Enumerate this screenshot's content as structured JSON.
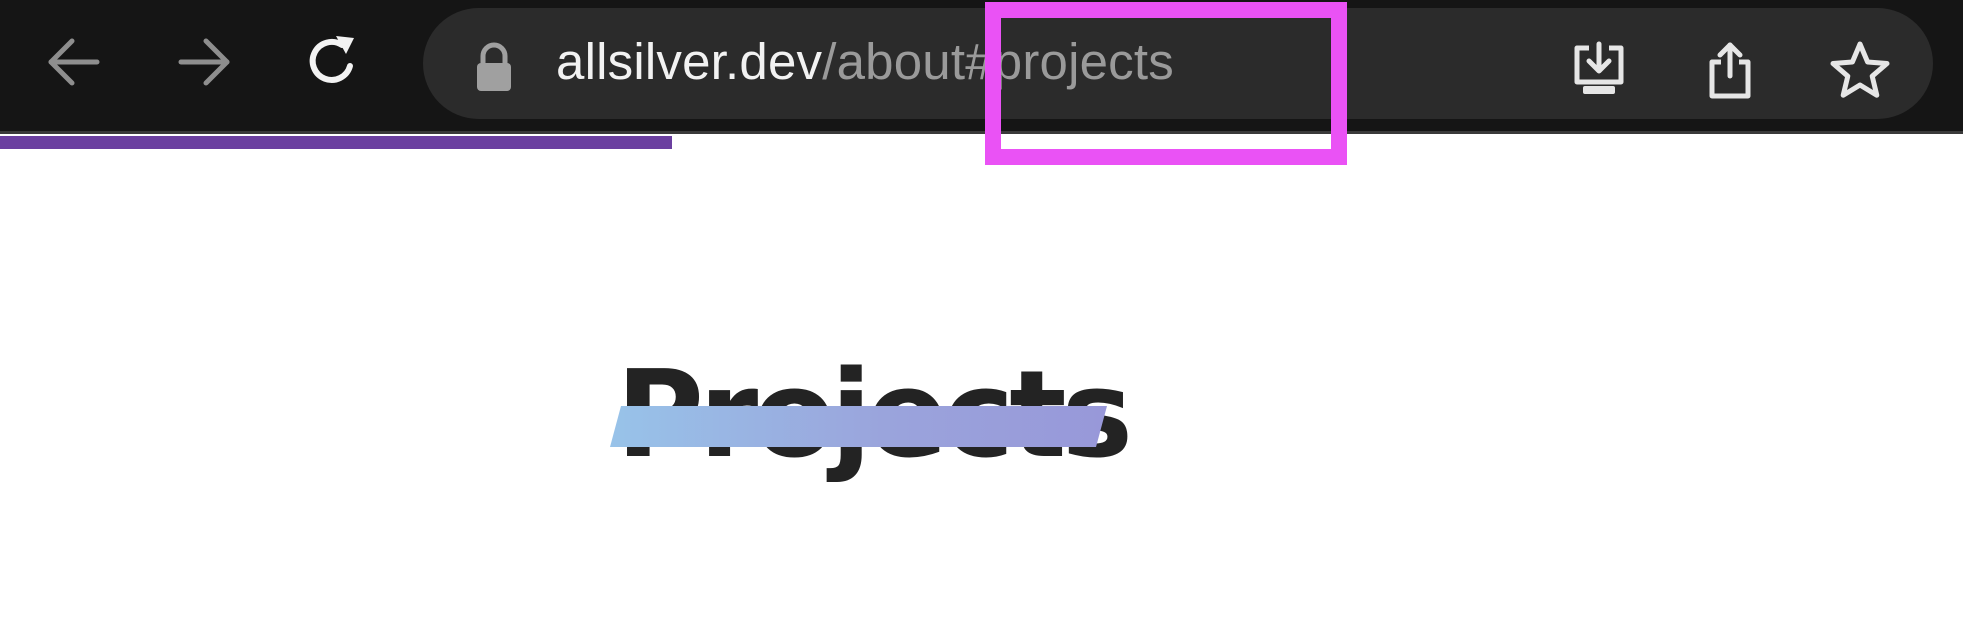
{
  "browser": {
    "nav": {
      "back_icon": "arrow-left-icon",
      "forward_icon": "arrow-right-icon",
      "reload_icon": "reload-icon"
    },
    "address_bar": {
      "lock_icon": "lock-icon",
      "url_host": "allsilver.dev",
      "url_path": "/about#projects"
    },
    "actions": {
      "download_icon": "download-icon",
      "share_icon": "share-icon",
      "bookmark_icon": "star-icon"
    },
    "highlight_color": "#ea52f5",
    "progress_color": "#6b3fa0"
  },
  "page": {
    "heading": "Projects",
    "heading_color": "#232323",
    "underline_gradient": [
      "#98c3e9",
      "#9898d9"
    ]
  }
}
